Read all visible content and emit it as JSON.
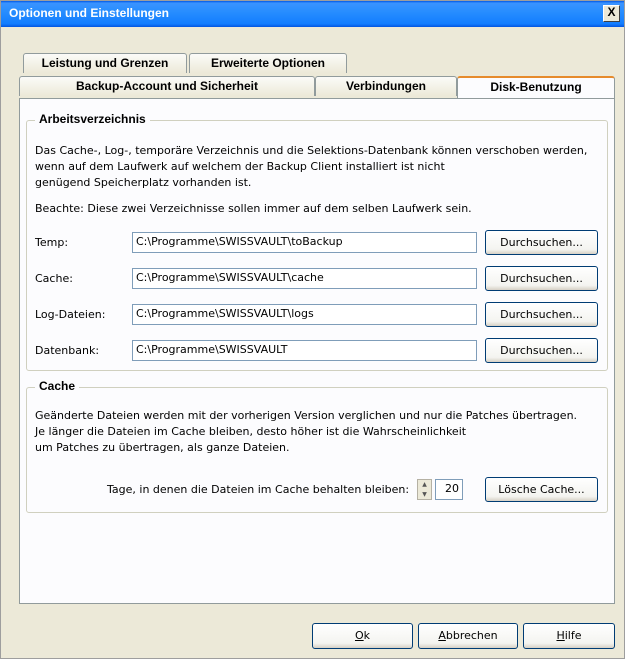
{
  "window": {
    "title": "Optionen und Einstellungen",
    "close_label": "X"
  },
  "tabs_back": [
    {
      "label": "Leistung und Grenzen"
    },
    {
      "label": "Erweiterte Optionen"
    }
  ],
  "tabs_front": [
    {
      "label": "Backup-Account und Sicherheit"
    },
    {
      "label": "Verbindungen"
    },
    {
      "label": "Disk-Benutzung",
      "active": true
    }
  ],
  "workdir": {
    "title": "Arbeitsverzeichnis",
    "desc_lines": [
      "Das Cache-, Log-, temporäre Verzeichnis und die Selektions-Datenbank können verschoben werden,",
      "wenn auf dem Laufwerk auf welchem der Backup Client installiert ist nicht",
      "genügend Speicherplatz vorhanden ist."
    ],
    "note": "Beachte: Diese zwei Verzeichnisse sollen immer auf dem selben Laufwerk sein.",
    "rows": [
      {
        "label": "Temp:",
        "value": "C:\\Programme\\SWISSVAULT\\toBackup",
        "button": "Durchsuchen..."
      },
      {
        "label": "Cache:",
        "value": "C:\\Programme\\SWISSVAULT\\cache",
        "button": "Durchsuchen..."
      },
      {
        "label": "Log-Dateien:",
        "value": "C:\\Programme\\SWISSVAULT\\logs",
        "button": "Durchsuchen..."
      },
      {
        "label": "Datenbank:",
        "value": "C:\\Programme\\SWISSVAULT",
        "button": "Durchsuchen..."
      }
    ]
  },
  "cache": {
    "title": "Cache",
    "desc_lines": [
      "Geänderte Dateien werden mit der vorherigen Version verglichen und nur die Patches übertragen.",
      "Je länger die Dateien im Cache bleiben, desto höher ist die Wahrscheinlichkeit",
      "um Patches zu übertragen, als ganze Dateien."
    ],
    "days_label": "Tage, in denen die Dateien im Cache behalten bleiben:",
    "days_value": "20",
    "clear_button": "Lösche Cache..."
  },
  "footer": {
    "ok_mnemonic": "O",
    "ok_rest": "k",
    "cancel_mnemonic": "A",
    "cancel_rest": "bbrechen",
    "help_mnemonic": "H",
    "help_rest": "ilfe"
  }
}
